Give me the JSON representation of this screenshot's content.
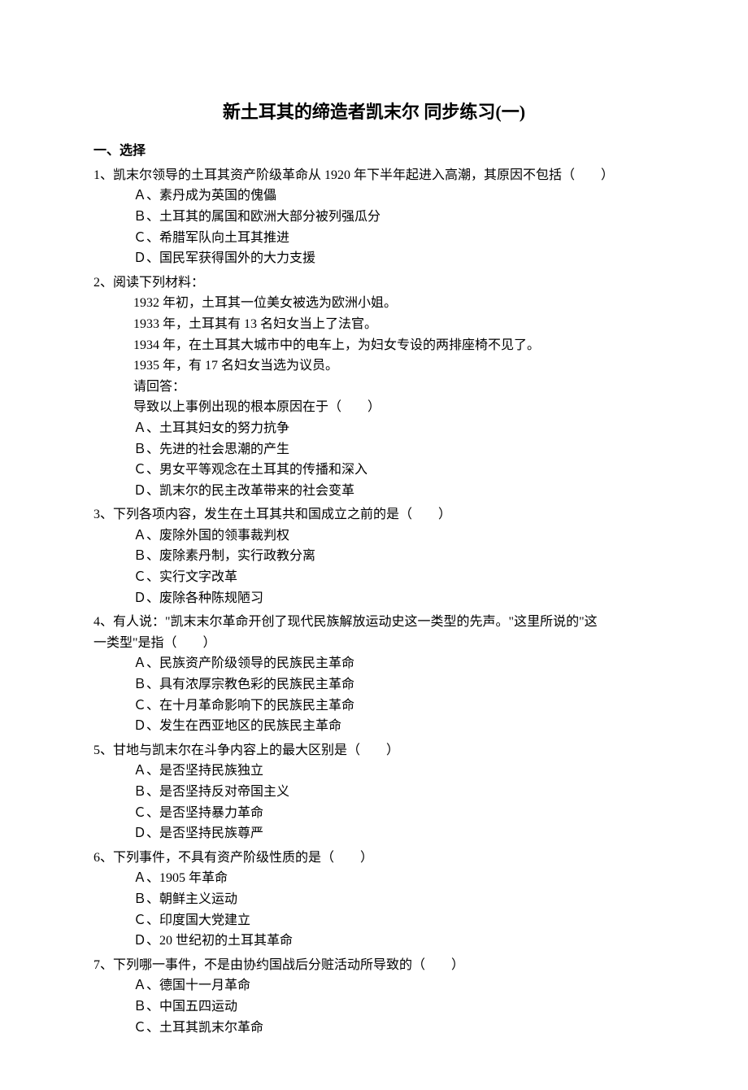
{
  "title": "新土耳其的缔造者凯末尔 同步练习(一)",
  "section_heading": "一、选择",
  "questions": [
    {
      "number": "1",
      "stem": "、凯末尔领导的土耳其资产阶级革命从 1920 年下半年起进入高潮，其原因不包括（　　）",
      "options": [
        "Ａ、素丹成为英国的傀儡",
        "Ｂ、土耳其的属国和欧洲大部分被列强瓜分",
        "Ｃ、希腊军队向土耳其推进",
        "Ｄ、国民军获得国外的大力支援"
      ]
    },
    {
      "number": "2",
      "stem": "、阅读下列材料：",
      "material": [
        "1932 年初，土耳其一位美女被选为欧洲小姐。",
        "1933 年，土耳其有 13 名妇女当上了法官。",
        "1934 年，在土耳其大城市中的电车上，为妇女专设的两排座椅不见了。",
        "1935 年，有 17 名妇女当选为议员。",
        "请回答：",
        "导致以上事例出现的根本原因在于（　　）"
      ],
      "options": [
        "Ａ、土耳其妇女的努力抗争",
        "Ｂ、先进的社会思潮的产生",
        "Ｃ、男女平等观念在土耳其的传播和深入",
        "Ｄ、凯末尔的民主改革带来的社会变革"
      ]
    },
    {
      "number": "3",
      "stem": "、下列各项内容，发生在土耳其共和国成立之前的是（　　）",
      "options": [
        "Ａ、废除外国的领事裁判权",
        "Ｂ、废除素丹制，实行政教分离",
        "Ｃ、实行文字改革",
        "Ｄ、废除各种陈规陋习"
      ]
    },
    {
      "number": "4",
      "stem": "、有人说：\"凯末末尔革命开创了现代民族解放运动史这一类型的先声。\"这里所说的\"这",
      "stem_continue": "一类型\"是指（　　）",
      "options": [
        "Ａ、民族资产阶级领导的民族民主革命",
        "Ｂ、具有浓厚宗教色彩的民族民主革命",
        "Ｃ、在十月革命影响下的民族民主革命",
        "Ｄ、发生在西亚地区的民族民主革命"
      ]
    },
    {
      "number": "5",
      "stem": "、甘地与凯末尔在斗争内容上的最大区别是（　　）",
      "options": [
        "Ａ、是否坚持民族独立",
        "Ｂ、是否坚持反对帝国主义",
        "Ｃ、是否坚持暴力革命",
        "Ｄ、是否坚持民族尊严"
      ]
    },
    {
      "number": "6",
      "stem": "、下列事件，不具有资产阶级性质的是（　　）",
      "options": [
        "Ａ、1905 年革命",
        "Ｂ、朝鲜主义运动",
        "Ｃ、印度国大党建立",
        "Ｄ、20 世纪初的土耳其革命"
      ]
    },
    {
      "number": "7",
      "stem": "、下列哪一事件，不是由协约国战后分赃活动所导致的（　　）",
      "options": [
        "Ａ、德国十一月革命",
        "Ｂ、中国五四运动",
        "Ｃ、土耳其凯末尔革命"
      ]
    }
  ]
}
